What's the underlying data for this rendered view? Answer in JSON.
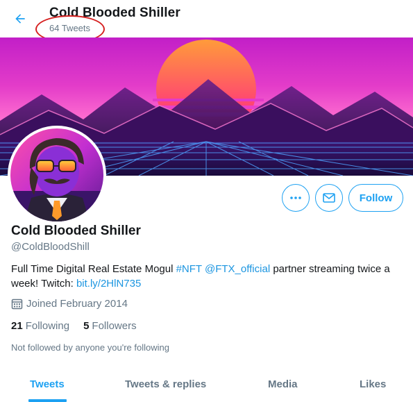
{
  "header": {
    "title": "Cold Blooded Shiller",
    "tweet_count": "64 Tweets"
  },
  "profile": {
    "display_name": "Cold Blooded Shiller",
    "handle": "@ColdBloodShill",
    "bio": {
      "text_1": "Full Time Digital Real Estate Mogul ",
      "hashtag": "#NFT",
      "mention": "@FTX_official",
      "text_2": " partner streaming twice a week! Twitch: ",
      "link": "bit.ly/2HlN735"
    },
    "joined": "Joined February 2014",
    "following_count": "21",
    "following_label": "Following",
    "followers_count": "5",
    "followers_label": "Followers",
    "not_followed": "Not followed by anyone you're following"
  },
  "actions": {
    "follow_label": "Follow"
  },
  "tabs": [
    {
      "label": "Tweets",
      "active": true
    },
    {
      "label": "Tweets & replies",
      "active": false
    },
    {
      "label": "Media",
      "active": false
    },
    {
      "label": "Likes",
      "active": false
    }
  ],
  "colors": {
    "accent": "#1da1f2",
    "annotation": "#d62020"
  }
}
